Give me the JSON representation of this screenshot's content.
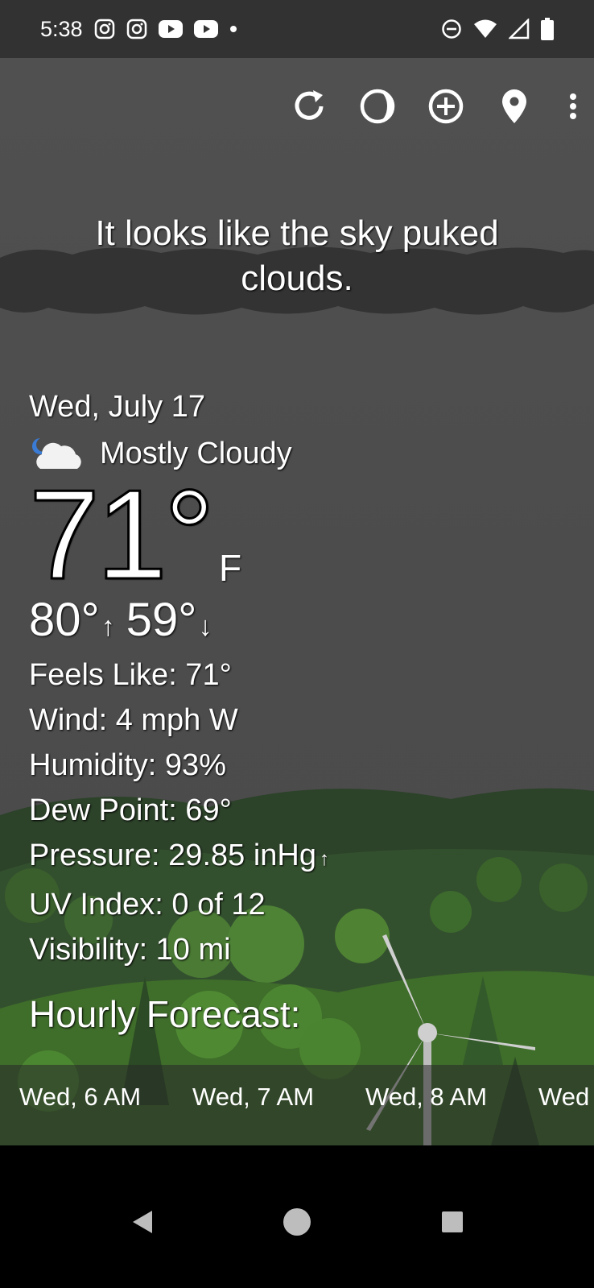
{
  "status_bar": {
    "time": "5:38",
    "notification_icons": [
      "instagram-icon",
      "instagram-icon",
      "youtube-icon",
      "youtube-icon",
      "dot-icon"
    ],
    "system_icons": [
      "dnd-icon",
      "wifi-icon",
      "cell-signal-icon",
      "battery-icon"
    ]
  },
  "toolbar": {
    "icons": [
      "refresh-icon",
      "theme-icon",
      "add-location-icon",
      "location-pin-icon",
      "more-options-icon"
    ]
  },
  "quip": "It looks like the sky puked clouds.",
  "current": {
    "date": "Wed, July 17",
    "condition_icon": "moon-cloud-icon",
    "condition": "Mostly Cloudy",
    "temperature": "71°",
    "unit": "F",
    "high": "80°",
    "low": "59°",
    "high_arrow": "↑",
    "low_arrow": "↓"
  },
  "details": {
    "feels_like": "Feels Like:  71°",
    "wind": "Wind:  4 mph W",
    "humidity": "Humidity:  93%",
    "dew_point": "Dew Point:  69°",
    "pressure": "Pressure:  29.85 inHg",
    "pressure_trend": "↑",
    "uv_index": "UV Index:  0 of 12",
    "visibility": "Visibility:  10 mi"
  },
  "hourly": {
    "title": "Hourly Forecast:",
    "hours": [
      "Wed, 6 AM",
      "Wed, 7 AM",
      "Wed, 8 AM",
      "Wed"
    ]
  },
  "nav_bar": {
    "icons": [
      "back-icon",
      "home-icon",
      "recents-icon"
    ]
  },
  "colors": {
    "status_bar_bg": "#323232",
    "sky": "#4c4c4c",
    "hills": "#2f4a2d",
    "trees": "#3d6b2a"
  }
}
